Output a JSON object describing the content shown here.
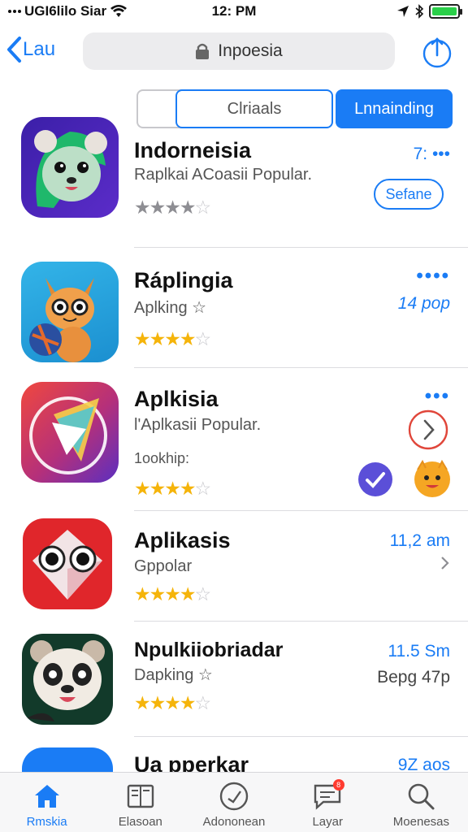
{
  "status_bar": {
    "carrier": "UGI6lilo Siar",
    "time": "12: PM"
  },
  "nav": {
    "back_label": "Lau",
    "url_text": "Inpoesia"
  },
  "segments": {
    "left": "Clriaals",
    "right": "Lnnainding"
  },
  "apps": [
    {
      "name": "Indorneisia",
      "subtitle": "Raplkai ACoasii Popular.",
      "rating": 3.5,
      "stars_style": "gray",
      "meta": "7: •••",
      "button": "Sefane"
    },
    {
      "name": "Ráplingia",
      "subtitle": "Aplking ☆",
      "rating": 3.5,
      "stars_style": "gold",
      "more": "••••",
      "meta": "14 pop"
    },
    {
      "name": "Aplkisia",
      "subtitle": "l'Aplkasii Popular.",
      "subtitle2": "1ookhip:",
      "rating": 4,
      "stars_style": "gold",
      "more": "•••"
    },
    {
      "name": "Aplikasis",
      "subtitle": "Gppolar",
      "rating": 4,
      "stars_style": "gold",
      "meta": "11,2 am"
    },
    {
      "name": "Npulkiiobriadar",
      "subtitle": "Dapking ☆",
      "rating": 4,
      "stars_style": "gold",
      "meta": "11.5 Sm",
      "meta2": "Bepg 47p"
    },
    {
      "name": "Ua pperkar",
      "meta": "9Z aos"
    }
  ],
  "tabs": [
    {
      "label": "Rmskia",
      "icon": "home-icon",
      "active": true
    },
    {
      "label": "Elasoan",
      "icon": "book-icon",
      "active": false
    },
    {
      "label": "Adononean",
      "icon": "clock-icon",
      "active": false
    },
    {
      "label": "Layar",
      "icon": "message-icon",
      "active": false,
      "badge": "8"
    },
    {
      "label": "Moenesas",
      "icon": "search-icon",
      "active": false
    }
  ],
  "colors": {
    "accent": "#1a7cf5",
    "star": "#f5b40a",
    "battery": "#2bd04a",
    "badge": "#ff3b30"
  }
}
